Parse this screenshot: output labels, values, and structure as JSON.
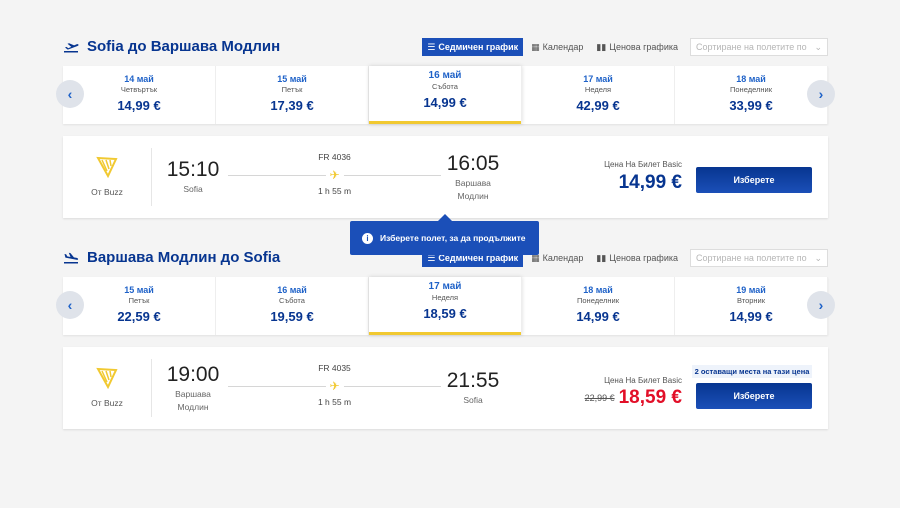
{
  "outbound": {
    "title": "Sofia до Варшава Модлин",
    "view_tabs": [
      {
        "icon": "list-icon",
        "label": "Седмичен график",
        "active": true
      },
      {
        "icon": "calendar-icon",
        "label": "Календар",
        "active": false
      },
      {
        "icon": "bar-chart-icon",
        "label": "Ценова графика",
        "active": false
      }
    ],
    "sort_placeholder": "Сортиране на полетите по",
    "dates": [
      {
        "date": "14 май",
        "weekday": "Четвъртък",
        "price": "14,99 €",
        "selected": false
      },
      {
        "date": "15 май",
        "weekday": "Петък",
        "price": "17,39 €",
        "selected": false
      },
      {
        "date": "16 май",
        "weekday": "Събота",
        "price": "14,99 €",
        "selected": true
      },
      {
        "date": "17 май",
        "weekday": "Неделя",
        "price": "42,99 €",
        "selected": false
      },
      {
        "date": "18 май",
        "weekday": "Понеделник",
        "price": "33,99 €",
        "selected": false
      }
    ],
    "flight": {
      "operator": "От Buzz",
      "dep_time": "15:10",
      "dep_city": [
        "Sofia"
      ],
      "flight_no": "FR 4036",
      "duration": "1 h 55 m",
      "arr_time": "16:05",
      "arr_city": [
        "Варшава",
        "Модлин"
      ],
      "price_label": "Цена На Билет Basic",
      "price": "14,99 €",
      "select_label": "Изберете"
    }
  },
  "tooltip": {
    "text": "Изберете полет, за да продължите",
    "icon": "info-icon"
  },
  "return": {
    "title": "Варшава Модлин до Sofia",
    "view_tabs": [
      {
        "icon": "list-icon",
        "label": "Седмичен график",
        "active": true
      },
      {
        "icon": "calendar-icon",
        "label": "Календар",
        "active": false
      },
      {
        "icon": "bar-chart-icon",
        "label": "Ценова графика",
        "active": false
      }
    ],
    "sort_placeholder": "Сортиране на полетите по",
    "dates": [
      {
        "date": "15 май",
        "weekday": "Петък",
        "price": "22,59 €",
        "selected": false
      },
      {
        "date": "16 май",
        "weekday": "Събота",
        "price": "19,59 €",
        "selected": false
      },
      {
        "date": "17 май",
        "weekday": "Неделя",
        "price": "18,59 €",
        "selected": true
      },
      {
        "date": "18 май",
        "weekday": "Понеделник",
        "price": "14,99 €",
        "selected": false
      },
      {
        "date": "19 май",
        "weekday": "Вторник",
        "price": "14,99 €",
        "selected": false
      }
    ],
    "flight": {
      "operator": "От Buzz",
      "dep_time": "19:00",
      "dep_city": [
        "Варшава",
        "Модлин"
      ],
      "flight_no": "FR 4035",
      "duration": "1 h 55 m",
      "arr_time": "21:55",
      "arr_city": [
        "Sofia"
      ],
      "seats_badge": "2 оставащи места на тази цена",
      "price_label": "Цена На Билет Basic",
      "old_price": "22,99 €",
      "price": "18,59 €",
      "select_label": "Изберете"
    }
  },
  "colors": {
    "brand_blue": "#073590",
    "accent_yellow": "#f1c931",
    "sale_red": "#e20f28"
  }
}
